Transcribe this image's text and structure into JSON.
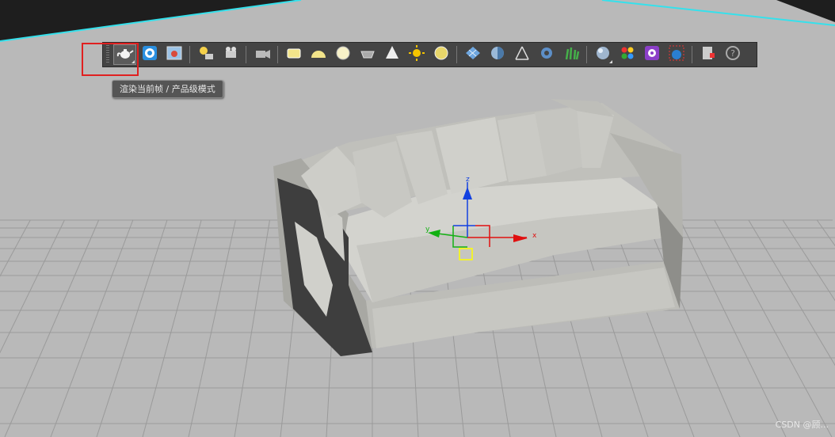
{
  "colors": {
    "viewport_bg": "#b9b9b9",
    "backdrop_dark": "#1e1e1e",
    "horizon_cyan": "#35e1ec",
    "grid_line": "#9a9a9a",
    "toolbar_bg": "#444444",
    "highlight_red": "#e02020",
    "gizmo_x": "#e01010",
    "gizmo_y": "#12b012",
    "gizmo_z": "#1240e0",
    "gizmo_center": "#ffff00"
  },
  "toolbar": {
    "groups": [
      [
        "render-production-teapot-icon",
        "render-setup-icon",
        "rendered-frame-window-icon"
      ],
      [
        "light-lister-icon",
        "camera-safe-frame-icon"
      ],
      [
        "video-camera-icon"
      ],
      [
        "plane-object-icon",
        "dome-object-icon",
        "sphere-light-icon",
        "basket-object-icon",
        "cone-object-icon",
        "sun-light-icon",
        "disc-light-icon"
      ],
      [
        "grid-pattern-icon",
        "half-sphere-icon",
        "tripod-target-icon",
        "gear-settings-icon",
        "grass-plants-icon"
      ],
      [
        "material-sphere-icon",
        "material-palette-icon",
        "render-elements-icon",
        "image-region-icon"
      ],
      [
        "clipboard-export-icon",
        "help-icon"
      ]
    ]
  },
  "tooltip": {
    "text": "渲染当前帧 / 产品级模式"
  },
  "gizmo": {
    "x_label": "x",
    "y_label": "y",
    "z_label": "z"
  },
  "watermark": {
    "text": "CSDN @顾..."
  }
}
